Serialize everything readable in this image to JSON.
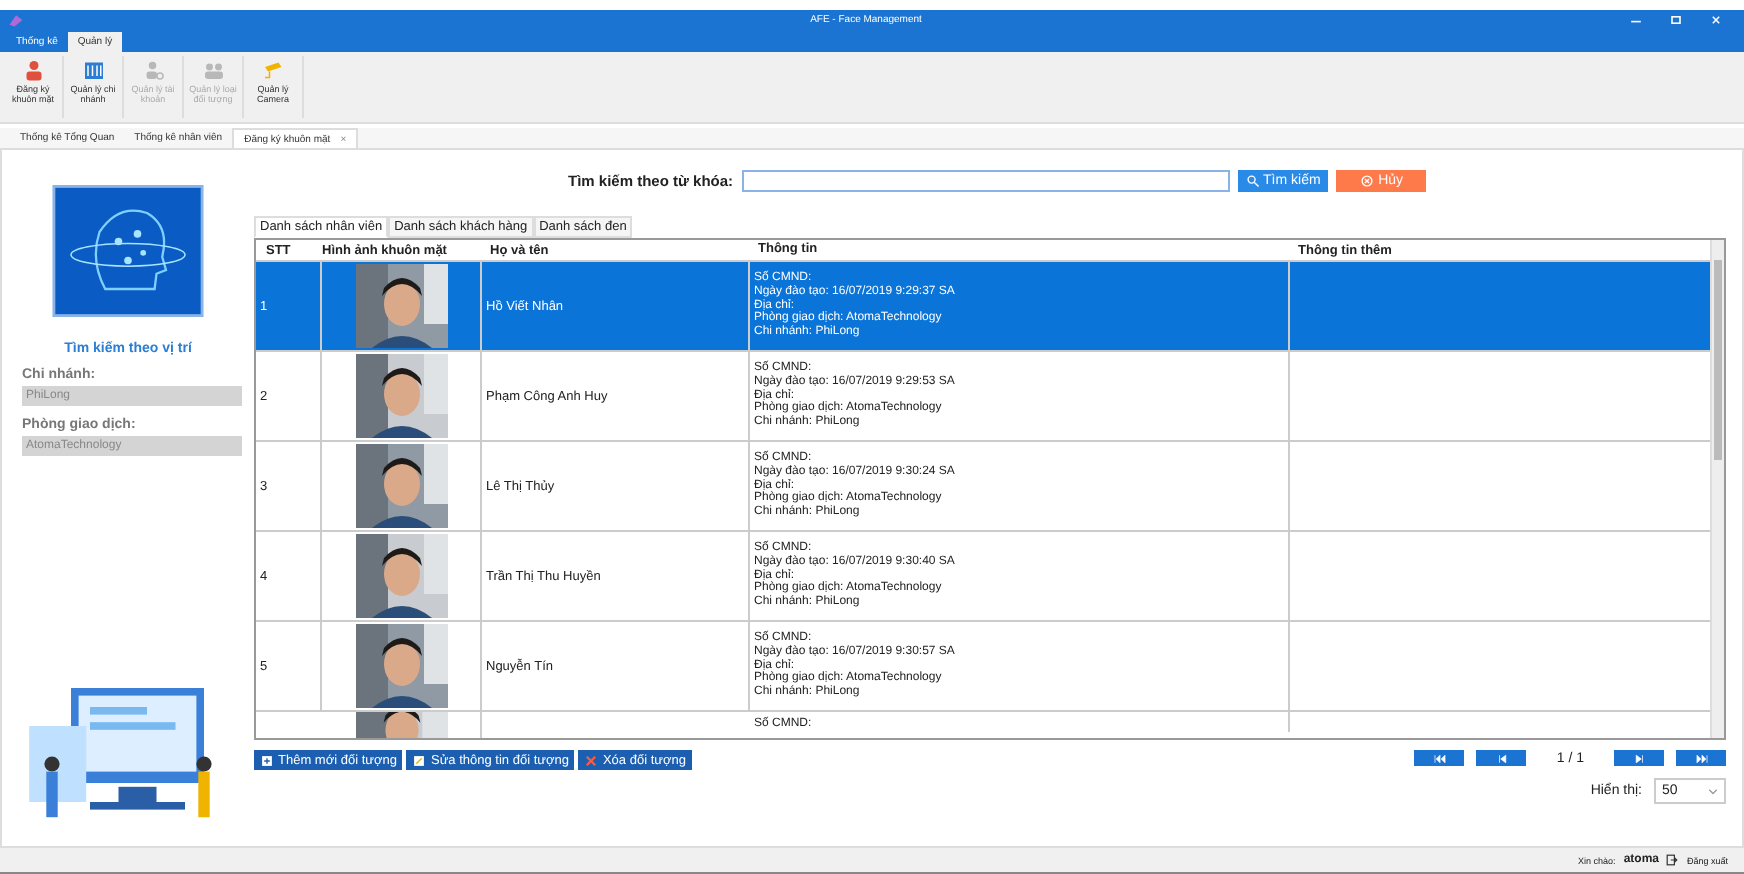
{
  "window": {
    "title": "AFE - Face Management"
  },
  "ribbon_tabs": [
    {
      "label": "Thống kê",
      "selected": false
    },
    {
      "label": "Quản lý",
      "selected": true
    }
  ],
  "ribbon_buttons": [
    {
      "label": "Đăng ký khuôn mặt",
      "kind": "person",
      "disabled": false
    },
    {
      "label": "Quản lý chi nhánh",
      "kind": "building",
      "disabled": false
    },
    {
      "label": "Quản lý tài khoản",
      "kind": "account",
      "disabled": true
    },
    {
      "label": "Quản lý loại đối tượng",
      "kind": "group",
      "disabled": true
    },
    {
      "label": "Quản lý Camera",
      "kind": "camera",
      "disabled": false
    }
  ],
  "doc_tabs": [
    {
      "label": "Thống kê Tổng Quan",
      "selected": false,
      "closable": false
    },
    {
      "label": "Thống kê nhân viên",
      "selected": false,
      "closable": false
    },
    {
      "label": "Đăng ký khuôn mặt",
      "selected": true,
      "closable": true
    }
  ],
  "close_glyph": "×",
  "sidebar": {
    "location_link": "Tìm kiếm theo vị trí",
    "branch_label": "Chi nhánh:",
    "branch_value": "PhiLong",
    "office_label": "Phòng giao dịch:",
    "office_value": "AtomaTechnology"
  },
  "search": {
    "label": "Tìm kiếm theo từ khóa:",
    "search_button": "Tìm kiếm",
    "cancel_button": "Hủy"
  },
  "list_tabs": [
    {
      "label": "Danh sách nhân viên",
      "selected": true
    },
    {
      "label": "Danh sách khách hàng",
      "selected": false
    },
    {
      "label": "Danh sách đen",
      "selected": false
    }
  ],
  "table": {
    "columns": [
      "STT",
      "Hình ảnh khuôn mặt",
      "Họ và tên",
      "Thông tin",
      "Thông tin thêm"
    ],
    "rows": [
      {
        "stt": "1",
        "name": "Hồ Viết Nhân",
        "info": [
          "Số CMND:",
          "Ngày đào tạo: 16/07/2019 9:29:37 SA",
          "Địa chỉ:",
          "Phòng giao dịch: AtomaTechnology",
          "Chi nhánh: PhiLong"
        ],
        "selected": true
      },
      {
        "stt": "2",
        "name": "Phạm Công Anh Huy",
        "info": [
          "Số CMND:",
          "Ngày đào tạo: 16/07/2019 9:29:53 SA",
          "Địa chỉ:",
          "Phòng giao dịch: AtomaTechnology",
          "Chi nhánh: PhiLong"
        ],
        "selected": false
      },
      {
        "stt": "3",
        "name": "Lê Thị Thủy",
        "info": [
          "Số CMND:",
          "Ngày đào tạo: 16/07/2019 9:30:24 SA",
          "Địa chỉ:",
          "Phòng giao dịch: AtomaTechnology",
          "Chi nhánh: PhiLong"
        ],
        "selected": false
      },
      {
        "stt": "4",
        "name": "Trần Thị Thu Huyền",
        "info": [
          "Số CMND:",
          "Ngày đào tạo: 16/07/2019 9:30:40 SA",
          "Địa chỉ:",
          "Phòng giao dịch: AtomaTechnology",
          "Chi nhánh: PhiLong"
        ],
        "selected": false
      },
      {
        "stt": "5",
        "name": "Nguyễn Tín",
        "info": [
          "Số CMND:",
          "Ngày đào tạo: 16/07/2019 9:30:57 SA",
          "Địa chỉ:",
          "Phòng giao dịch: AtomaTechnology",
          "Chi nhánh: PhiLong"
        ],
        "selected": false
      },
      {
        "stt": "",
        "name": "",
        "info": [
          "Số CMND:"
        ],
        "selected": false
      }
    ]
  },
  "actions": [
    "Thêm mới đối tượng",
    "Sửa thông tin đối tượng",
    "Xóa đối tượng"
  ],
  "pager": {
    "page": "1 / 1",
    "show_label": "Hiển thị:",
    "page_size": "50"
  },
  "status_bar": {
    "greeting": "Xin chào:",
    "user": "atoma",
    "logout": "Đăng xuất"
  }
}
